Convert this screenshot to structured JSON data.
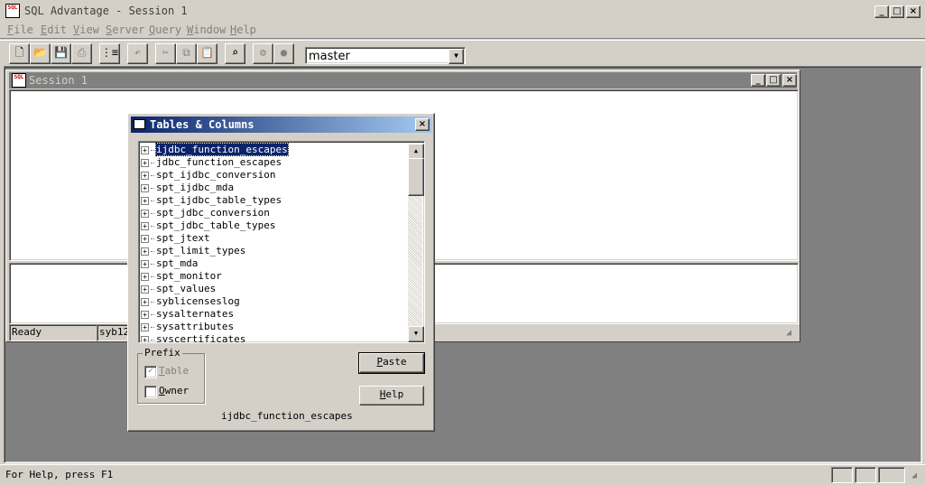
{
  "app": {
    "title": "SQL Advantage - Session 1",
    "icon_text": "SQL"
  },
  "menu": [
    {
      "key": "F",
      "rest": "ile"
    },
    {
      "key": "E",
      "rest": "dit"
    },
    {
      "key": "V",
      "rest": "iew"
    },
    {
      "key": "S",
      "rest": "erver"
    },
    {
      "key": "Q",
      "rest": "uery"
    },
    {
      "key": "W",
      "rest": "indow"
    },
    {
      "key": "H",
      "rest": "elp"
    }
  ],
  "toolbar": {
    "icons": [
      "new-file-icon",
      "open-folder-icon",
      "save-icon",
      "print-icon",
      "connect-icon",
      "undo-icon",
      "cut-icon",
      "copy-icon",
      "paste-icon",
      "find-icon",
      "execute-icon",
      "stop-icon"
    ],
    "database": "master"
  },
  "session": {
    "title": "Session 1",
    "status_ready": "Ready",
    "status_server": "syb12"
  },
  "dialog": {
    "title": "Tables & Columns",
    "tables": [
      "ijdbc_function_escapes",
      "jdbc_function_escapes",
      "spt_ijdbc_conversion",
      "spt_ijdbc_mda",
      "spt_ijdbc_table_types",
      "spt_jdbc_conversion",
      "spt_jdbc_table_types",
      "spt_jtext",
      "spt_limit_types",
      "spt_mda",
      "spt_monitor",
      "spt_values",
      "syblicenseslog",
      "sysalternates",
      "sysattributes",
      "syscertificates"
    ],
    "selected_index": 0,
    "prefix_label": "Prefix",
    "table_check_label": "Table",
    "table_check_key": "T",
    "owner_check_label": "Owner",
    "owner_check_key": "O",
    "table_checked": true,
    "owner_checked": false,
    "paste_label": "Paste",
    "paste_key": "P",
    "help_label": "Help",
    "help_key": "H",
    "selected_name": "ijdbc_function_escapes"
  },
  "statusbar": {
    "help_text": "For Help, press F1"
  },
  "colors": {
    "selection": "#0a246a",
    "face": "#d4d0c8",
    "workspace": "#808080"
  }
}
